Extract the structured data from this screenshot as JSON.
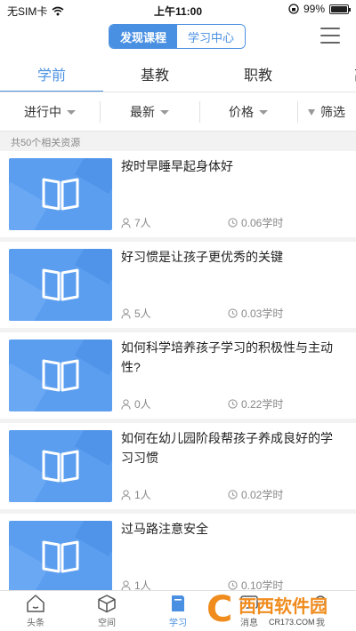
{
  "status": {
    "carrier": "无SIM卡",
    "time": "上午11:00",
    "battery": "99%",
    "battery_level": 0.99
  },
  "header": {
    "segments": [
      "发现课程",
      "学习中心"
    ],
    "active_segment": 0
  },
  "categories": [
    "学前",
    "基教",
    "职教",
    "高"
  ],
  "filters": {
    "status": "进行中",
    "sort": "最新",
    "price": "价格",
    "more": "筛选"
  },
  "result_count": "共50个相关资源",
  "courses": [
    {
      "title": "按时早睡早起身体好",
      "learners": "7人",
      "hours": "0.06学时"
    },
    {
      "title": "好习惯是让孩子更优秀的关键",
      "learners": "5人",
      "hours": "0.03学时"
    },
    {
      "title": "如何科学培养孩子学习的积极性与主动性?",
      "learners": "0人",
      "hours": "0.22学时"
    },
    {
      "title": "如何在幼儿园阶段帮孩子养成良好的学习习惯",
      "learners": "1人",
      "hours": "0.02学时"
    },
    {
      "title": "过马路注意安全",
      "learners": "1人",
      "hours": "0.10学时"
    }
  ],
  "tabbar": [
    "头条",
    "空间",
    "学习",
    "消息",
    "我"
  ],
  "watermark": {
    "main": "西西软件园",
    "url": "CR173.COM"
  },
  "colors": {
    "accent": "#4a90e2",
    "thumbnail": "#5b9ef0",
    "watermark": "#f08c1e"
  }
}
